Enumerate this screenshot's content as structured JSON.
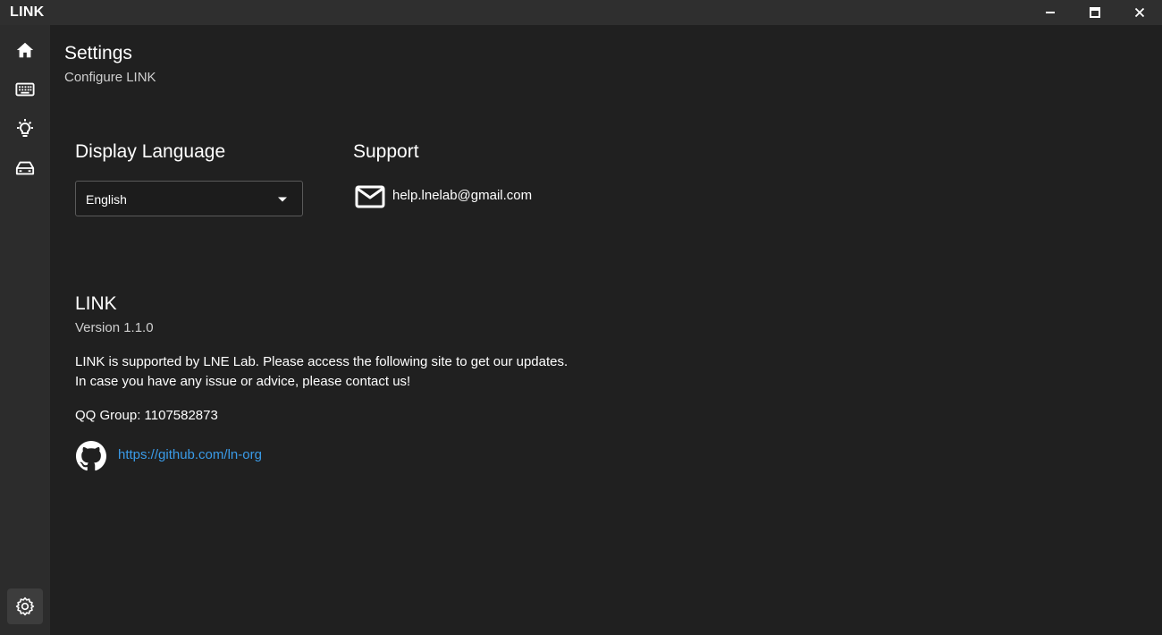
{
  "window": {
    "title": "LINK",
    "controls": {
      "minimize": "minimize-icon",
      "maximize": "maximize-icon",
      "close": "close-icon"
    }
  },
  "sidebar": {
    "items": [
      {
        "id": "home",
        "icon": "home-icon",
        "active": false
      },
      {
        "id": "keyboard",
        "icon": "keyboard-icon",
        "active": false
      },
      {
        "id": "lighting",
        "icon": "lightbulb-icon",
        "active": false
      },
      {
        "id": "drive",
        "icon": "drive-icon",
        "active": false
      },
      {
        "id": "settings",
        "icon": "gear-icon",
        "active": true
      }
    ]
  },
  "header": {
    "title": "Settings",
    "subtitle": "Configure LINK"
  },
  "display_language": {
    "heading": "Display Language",
    "selected": "English"
  },
  "support": {
    "heading": "Support",
    "email": "help.lnelab@gmail.com"
  },
  "about": {
    "title": "LINK",
    "version": "Version 1.1.0",
    "line1": "LINK is supported by LNE Lab. Please access the following site to get our updates.",
    "line2": "In case you have any issue or advice, please contact us!",
    "qq": "QQ Group: 1107582873",
    "link": "https://github.com/ln-org"
  },
  "colors": {
    "background": "#202020",
    "titlebar": "#2f2f2f",
    "sidebar": "#2c2c2c",
    "active_nav": "#3d3d3d",
    "link": "#3a9be8",
    "text": "#ffffff",
    "muted_text": "#cfcfcf"
  }
}
